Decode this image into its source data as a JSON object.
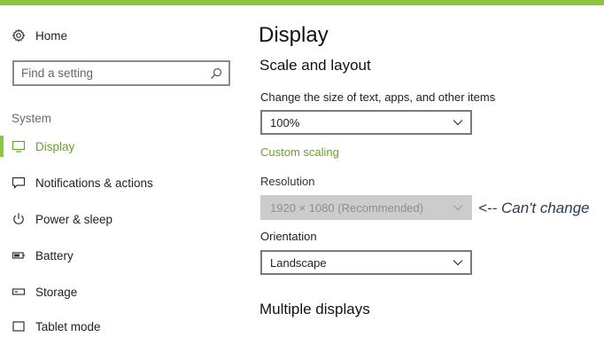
{
  "accent_color": "#8cc63f",
  "link_color": "#6aa325",
  "sidebar": {
    "home": {
      "label": "Home",
      "icon": "gear-icon"
    },
    "search": {
      "placeholder": "Find a setting",
      "icon": "search-icon"
    },
    "section_label": "System",
    "items": [
      {
        "label": "Display",
        "icon": "monitor-icon",
        "active": true
      },
      {
        "label": "Notifications & actions",
        "icon": "notification-icon",
        "active": false
      },
      {
        "label": "Power & sleep",
        "icon": "power-icon",
        "active": false
      },
      {
        "label": "Battery",
        "icon": "battery-icon",
        "active": false
      },
      {
        "label": "Storage",
        "icon": "storage-icon",
        "active": false
      },
      {
        "label": "Tablet mode",
        "icon": "tablet-icon",
        "active": false
      }
    ]
  },
  "main": {
    "title": "Display",
    "scale_section": {
      "heading": "Scale and layout",
      "size_label": "Change the size of text, apps, and other items",
      "size_value": "100%",
      "custom_scaling_link": "Custom scaling",
      "resolution_label": "Resolution",
      "resolution_value": "1920 × 1080 (Recommended)",
      "resolution_disabled": true,
      "orientation_label": "Orientation",
      "orientation_value": "Landscape"
    },
    "multiple_displays_heading": "Multiple displays"
  },
  "annotation": "<-- Can't change"
}
